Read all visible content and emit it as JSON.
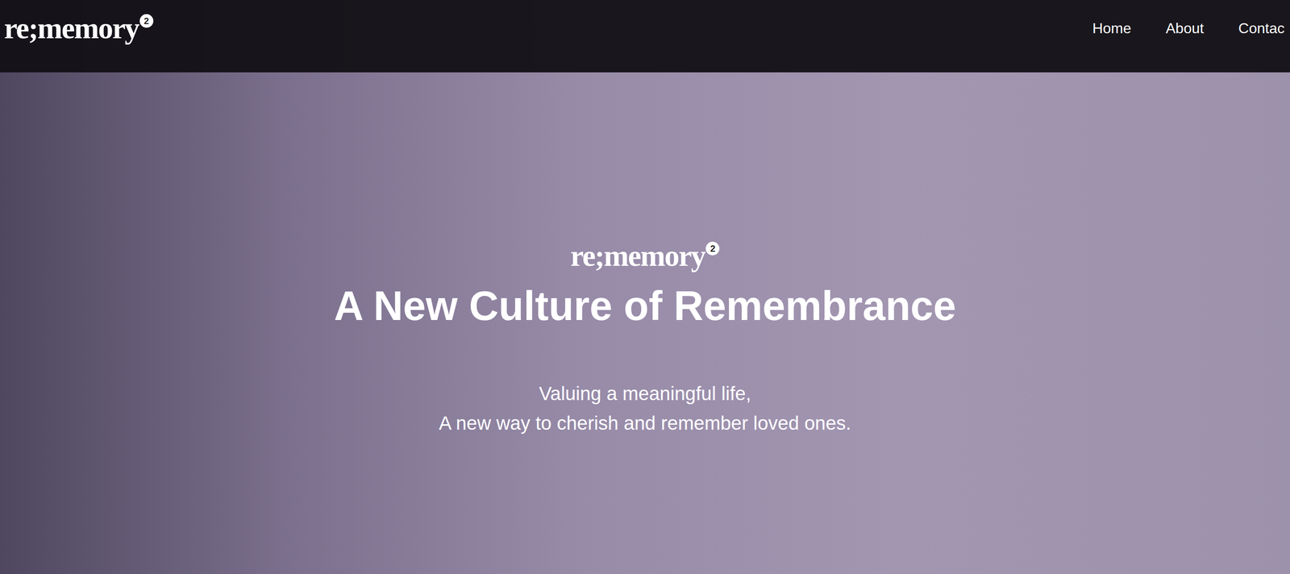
{
  "header": {
    "logo": {
      "text": "re;memory",
      "badge": "2"
    },
    "nav": [
      {
        "label": "Home"
      },
      {
        "label": "About"
      },
      {
        "label": "Contac"
      }
    ]
  },
  "hero": {
    "logo": {
      "text": "re;memory",
      "badge": "2"
    },
    "title": "A New Culture of Remembrance",
    "subtitle": [
      "Valuing a meaningful life,",
      "A new way to cherish and remember loved ones."
    ]
  }
}
